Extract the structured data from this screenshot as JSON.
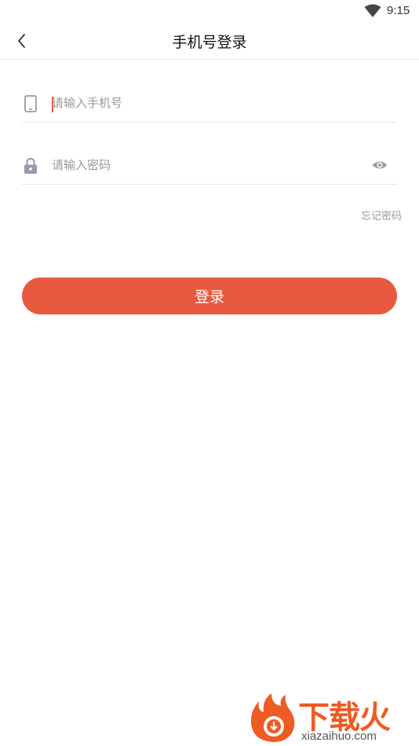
{
  "status_bar": {
    "time": "9:15",
    "wifi_icon": "wifi-icon"
  },
  "header": {
    "title": "手机号登录",
    "back_icon": "chevron-left-icon"
  },
  "phone_field": {
    "placeholder": "请输入手机号",
    "value": "",
    "icon": "phone-icon"
  },
  "password_field": {
    "placeholder": "请输入密码",
    "value": "",
    "icon": "lock-icon",
    "visibility_icon": "eye-icon"
  },
  "forgot_password_label": "忘记密码",
  "login_button_label": "登录",
  "watermark": {
    "brand": "下载火",
    "site": "xiazaihuo.com"
  },
  "colors": {
    "accent": "#e85a40",
    "placeholder": "#999999",
    "divider": "#e6e6e6",
    "icon": "#9a9aa8"
  }
}
